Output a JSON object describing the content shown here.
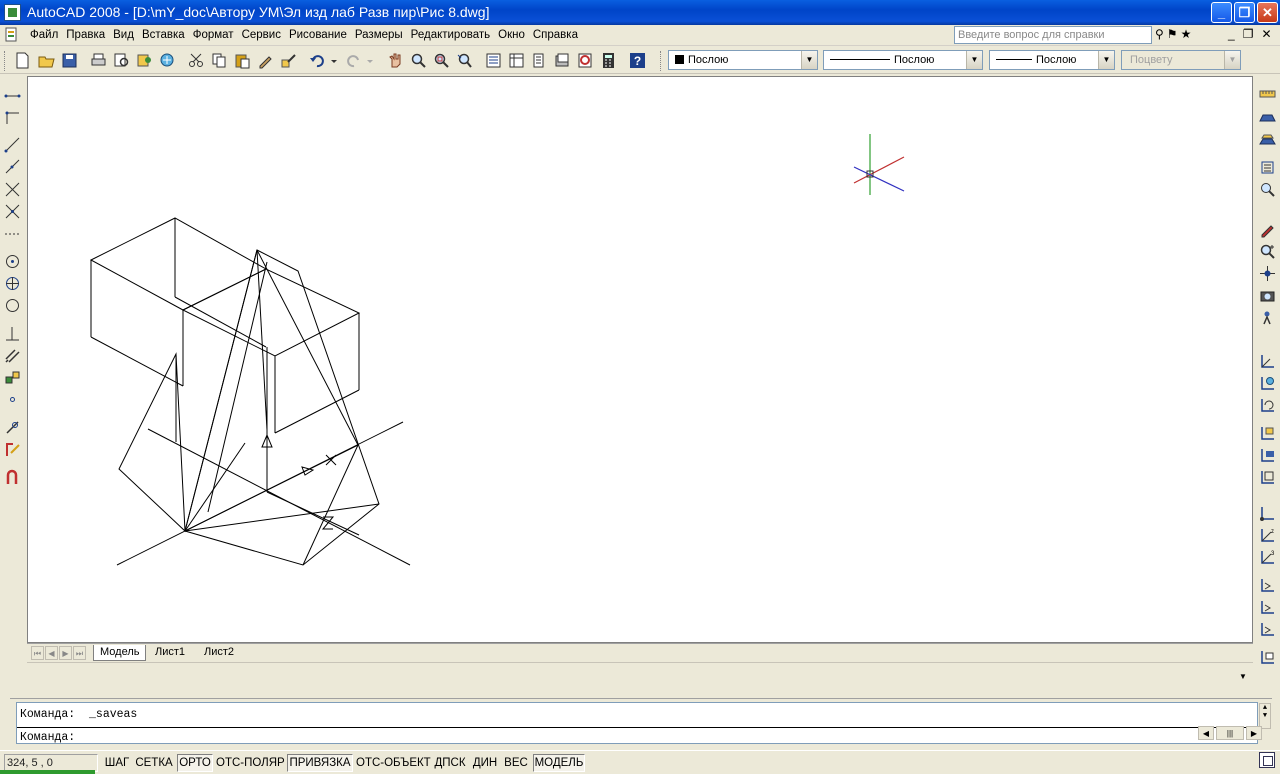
{
  "window": {
    "title": "AutoCAD 2008 - [D:\\mY_doc\\Автору УМ\\Эл изд лаб Разв пир\\Рис 8.dwg]",
    "minimize": "_",
    "restore": "❐",
    "close": "✕"
  },
  "menu": {
    "items": [
      "Файл",
      "Правка",
      "Вид",
      "Вставка",
      "Формат",
      "Сервис",
      "Рисование",
      "Размеры",
      "Редактировать",
      "Окно",
      "Справка"
    ],
    "help_placeholder": "Введите вопрос для справки",
    "mdi_minimize": "_",
    "mdi_restore": "❐",
    "mdi_close": "✕"
  },
  "toolbar": {
    "color_combo": "Послою",
    "linetype_combo": "Послою",
    "lineweight_combo": "Послою",
    "plotstyle_combo": "Поцвету",
    "icons": [
      "new-icon",
      "open-icon",
      "save-icon",
      "plot-icon",
      "plot-preview-icon",
      "publish-icon",
      "3d-dwf-icon",
      "cut-icon",
      "copy-icon",
      "paste-icon",
      "match-properties-icon",
      "block-editor-icon",
      "undo-icon",
      "redo-icon",
      "pan-icon",
      "zoom-realtime-icon",
      "zoom-window-icon",
      "zoom-previous-icon",
      "properties-icon",
      "design-center-icon",
      "tool-palettes-icon",
      "sheet-set-icon",
      "markup-icon",
      "quickcalc-icon",
      "help-icon"
    ]
  },
  "tabs": {
    "items": [
      "Модель",
      "Лист1",
      "Лист2"
    ],
    "active": "Модель"
  },
  "command": {
    "line1": "Команда:  _saveas",
    "line2": "Команда:"
  },
  "status": {
    "coords": "324, 5  , 0",
    "buttons": [
      "ШАГ",
      "СЕТКА",
      "ОРТО",
      "ОТС-ПОЛЯР",
      "ПРИВЯЗКА",
      "ОТС-ОБЪЕКТ",
      "ДПСК",
      "ДИН",
      "ВЕС",
      "МОДЕЛЬ"
    ],
    "active_buttons": [
      "ОРТО",
      "ПРИВЯЗКА",
      "МОДЕЛЬ"
    ]
  },
  "colors": {
    "titlebar": "#0a50d6",
    "chrome": "#ece9d8",
    "canvas": "#ffffff",
    "ucs_x_axis": "#c03030",
    "ucs_y_axis": "#30a030",
    "ucs_z_axis": "#3030c0"
  }
}
